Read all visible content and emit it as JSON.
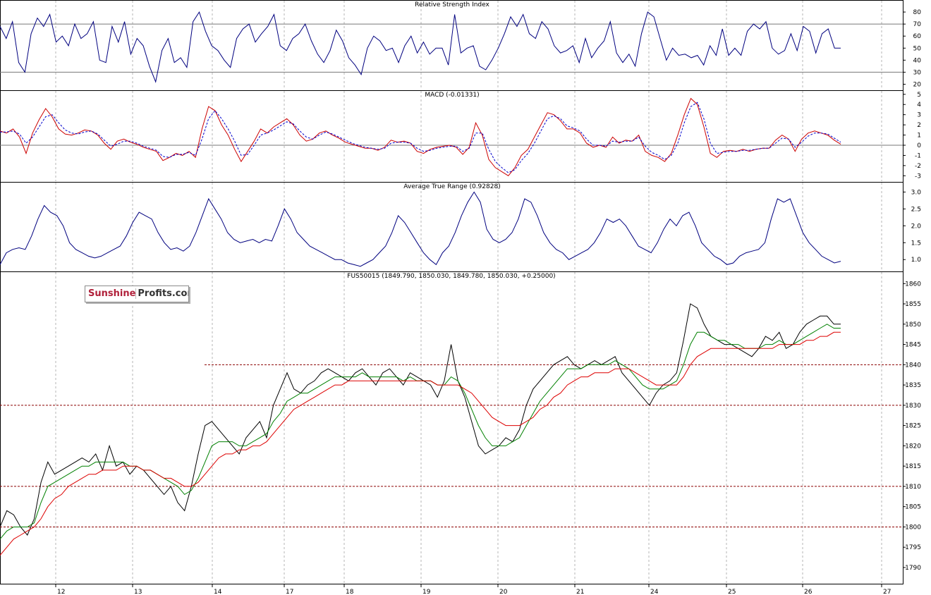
{
  "chart_data": [
    {
      "type": "line",
      "title": "Relative Strength Index",
      "ylim": [
        15,
        90
      ],
      "y_ticks": [
        20,
        30,
        40,
        50,
        60,
        70,
        80
      ],
      "reference_lines": [
        30,
        70
      ],
      "series": [
        {
          "color": "#00007f",
          "values": [
            68,
            58,
            72,
            38,
            30,
            62,
            75,
            68,
            78,
            55,
            60,
            52,
            70,
            58,
            62,
            72,
            40,
            38,
            68,
            55,
            72,
            45,
            58,
            52,
            35,
            22,
            48,
            58,
            38,
            42,
            34,
            72,
            80,
            64,
            52,
            48,
            40,
            34,
            58,
            66,
            70,
            55,
            62,
            68,
            78,
            52,
            48,
            58,
            62,
            70,
            56,
            45,
            38,
            48,
            65,
            56,
            42,
            36,
            28,
            50,
            60,
            56,
            48,
            50,
            38,
            52,
            60,
            46,
            55,
            45,
            50,
            50,
            36,
            78,
            46,
            50,
            52,
            35,
            32,
            40,
            50,
            62,
            76,
            68,
            78,
            62,
            58,
            72,
            66,
            52,
            46,
            48,
            52,
            38,
            58,
            42,
            50,
            56,
            72,
            46,
            38,
            45,
            35,
            62,
            80,
            76,
            58,
            40,
            50,
            44,
            45,
            42,
            44,
            36,
            52,
            44,
            66,
            44,
            50,
            44,
            64,
            70,
            66,
            72,
            50,
            45,
            48,
            62,
            48,
            68,
            64,
            46,
            62,
            66,
            50,
            50
          ]
        }
      ]
    },
    {
      "type": "line",
      "title": "MACD (-0.01331)",
      "ylim": [
        -3.6,
        5.4
      ],
      "y_ticks": [
        -3,
        -2,
        -1,
        0,
        1,
        2,
        3,
        4,
        5
      ],
      "reference_lines": [
        0
      ],
      "series": [
        {
          "color": "#cc0000",
          "values": [
            1.4,
            1.2,
            1.6,
            0.8,
            -0.8,
            1.2,
            2.5,
            3.6,
            2.8,
            1.6,
            1.1,
            1.0,
            1.2,
            1.5,
            1.4,
            1.0,
            0.2,
            -0.4,
            0.4,
            0.6,
            0.3,
            0.1,
            -0.2,
            -0.4,
            -0.6,
            -1.5,
            -1.2,
            -0.8,
            -1.0,
            -0.6,
            -1.2,
            1.6,
            3.8,
            3.4,
            2.0,
            1.0,
            -0.4,
            -1.6,
            -0.6,
            0.4,
            1.6,
            1.2,
            1.8,
            2.2,
            2.6,
            2.0,
            1.0,
            0.4,
            0.6,
            1.2,
            1.4,
            1.0,
            0.7,
            0.3,
            0.1,
            -0.1,
            -0.3,
            -0.3,
            -0.5,
            -0.2,
            0.5,
            0.3,
            0.4,
            0.2,
            -0.6,
            -0.8,
            -0.4,
            -0.2,
            -0.1,
            0.0,
            -0.2,
            -0.9,
            -0.2,
            2.2,
            1.0,
            -1.4,
            -2.2,
            -2.6,
            -3.0,
            -2.2,
            -1.0,
            -0.4,
            0.8,
            2.0,
            3.2,
            3.0,
            2.4,
            1.6,
            1.6,
            1.2,
            0.2,
            -0.2,
            0.0,
            -0.2,
            0.8,
            0.2,
            0.5,
            0.4,
            1.0,
            -0.6,
            -1.0,
            -1.2,
            -1.6,
            -0.8,
            1.0,
            3.0,
            4.6,
            4.0,
            1.8,
            -0.8,
            -1.2,
            -0.6,
            -0.5,
            -0.6,
            -0.4,
            -0.6,
            -0.4,
            -0.3,
            -0.3,
            0.5,
            1.0,
            0.6,
            -0.6,
            0.6,
            1.2,
            1.4,
            1.2,
            1.0,
            0.5,
            0.1
          ]
        },
        {
          "color": "#0000cc",
          "dashed": true,
          "values": [
            1.3,
            1.3,
            1.4,
            1.1,
            0.2,
            0.8,
            1.8,
            2.8,
            3.0,
            2.2,
            1.5,
            1.2,
            1.1,
            1.3,
            1.4,
            1.1,
            0.5,
            -0.1,
            0.1,
            0.4,
            0.4,
            0.2,
            -0.1,
            -0.3,
            -0.5,
            -1.1,
            -1.2,
            -0.9,
            -0.9,
            -0.7,
            -1.0,
            0.6,
            2.6,
            3.4,
            2.6,
            1.6,
            0.4,
            -1.0,
            -0.9,
            0.0,
            1.0,
            1.2,
            1.5,
            1.9,
            2.3,
            2.1,
            1.4,
            0.8,
            0.6,
            1.0,
            1.3,
            1.1,
            0.8,
            0.5,
            0.2,
            0.0,
            -0.2,
            -0.3,
            -0.4,
            -0.3,
            0.2,
            0.3,
            0.3,
            0.2,
            -0.3,
            -0.6,
            -0.5,
            -0.3,
            -0.2,
            -0.1,
            -0.1,
            -0.6,
            -0.3,
            1.2,
            1.2,
            -0.4,
            -1.6,
            -2.2,
            -2.7,
            -2.4,
            -1.5,
            -0.8,
            0.2,
            1.4,
            2.6,
            2.9,
            2.6,
            1.9,
            1.7,
            1.4,
            0.6,
            0.0,
            0.0,
            -0.1,
            0.4,
            0.3,
            0.4,
            0.4,
            0.8,
            -0.1,
            -0.7,
            -1.0,
            -1.4,
            -1.0,
            0.2,
            2.2,
            3.8,
            4.2,
            2.6,
            0.2,
            -0.8,
            -0.7,
            -0.6,
            -0.6,
            -0.5,
            -0.5,
            -0.4,
            -0.3,
            -0.3,
            0.2,
            0.7,
            0.6,
            -0.2,
            0.3,
            0.9,
            1.2,
            1.2,
            1.1,
            0.7,
            0.3
          ]
        }
      ]
    },
    {
      "type": "line",
      "title": "Average True Range (0.92828)",
      "ylim": [
        0.65,
        3.3
      ],
      "y_ticks": [
        1.0,
        1.5,
        2.0,
        2.5,
        3.0
      ],
      "series": [
        {
          "color": "#00007f",
          "values": [
            0.85,
            1.2,
            1.3,
            1.35,
            1.3,
            1.7,
            2.2,
            2.6,
            2.4,
            2.3,
            2.0,
            1.5,
            1.3,
            1.2,
            1.1,
            1.05,
            1.1,
            1.2,
            1.3,
            1.4,
            1.7,
            2.1,
            2.4,
            2.3,
            2.2,
            1.8,
            1.5,
            1.3,
            1.35,
            1.25,
            1.4,
            1.8,
            2.3,
            2.8,
            2.5,
            2.2,
            1.8,
            1.6,
            1.5,
            1.55,
            1.6,
            1.5,
            1.6,
            1.55,
            2.0,
            2.5,
            2.2,
            1.8,
            1.6,
            1.4,
            1.3,
            1.2,
            1.1,
            1.0,
            1.0,
            0.9,
            0.85,
            0.8,
            0.9,
            1.0,
            1.2,
            1.4,
            1.8,
            2.3,
            2.1,
            1.8,
            1.5,
            1.2,
            1.0,
            0.85,
            1.2,
            1.4,
            1.8,
            2.3,
            2.7,
            3.0,
            2.7,
            1.9,
            1.6,
            1.5,
            1.6,
            1.8,
            2.2,
            2.8,
            2.7,
            2.3,
            1.8,
            1.5,
            1.3,
            1.2,
            1.0,
            1.1,
            1.2,
            1.3,
            1.5,
            1.8,
            2.2,
            2.1,
            2.2,
            2.0,
            1.7,
            1.4,
            1.3,
            1.2,
            1.5,
            1.9,
            2.2,
            2.0,
            2.3,
            2.4,
            2.0,
            1.5,
            1.3,
            1.1,
            1.0,
            0.85,
            0.9,
            1.1,
            1.2,
            1.25,
            1.3,
            1.5,
            2.2,
            2.8,
            2.7,
            2.8,
            2.3,
            1.8,
            1.5,
            1.3,
            1.1,
            1.0,
            0.9,
            0.95
          ]
        }
      ]
    },
    {
      "type": "line",
      "title": "FUS50015 (1849.790, 1850.030, 1849.780, 1850.030, +0.25000)",
      "ylim": [
        1786,
        1863
      ],
      "y_ticks": [
        1790,
        1795,
        1800,
        1805,
        1810,
        1815,
        1820,
        1825,
        1830,
        1835,
        1840,
        1845,
        1850,
        1855,
        1860
      ],
      "x_ticks": [
        "12",
        "13",
        "14",
        "17",
        "18",
        "19",
        "20",
        "21",
        "24",
        "25",
        "26",
        "27"
      ],
      "reference_lines": [
        1800,
        1810,
        1830,
        1840
      ],
      "series": [
        {
          "color": "#000000",
          "values": [
            1800,
            1804,
            1803,
            1800,
            1798,
            1802,
            1811,
            1816,
            1813,
            1814,
            1815,
            1816,
            1817,
            1816,
            1818,
            1814,
            1820,
            1815,
            1816,
            1813,
            1815,
            1814,
            1812,
            1810,
            1808,
            1810,
            1806,
            1804,
            1810,
            1818,
            1825,
            1826,
            1824,
            1822,
            1820,
            1818,
            1822,
            1824,
            1826,
            1822,
            1830,
            1834,
            1838,
            1834,
            1833,
            1835,
            1836,
            1838,
            1839,
            1838,
            1837,
            1836,
            1838,
            1839,
            1837,
            1835,
            1838,
            1839,
            1837,
            1835,
            1838,
            1837,
            1836,
            1835,
            1832,
            1836,
            1845,
            1836,
            1832,
            1826,
            1820,
            1818,
            1819,
            1820,
            1822,
            1821,
            1824,
            1830,
            1834,
            1836,
            1838,
            1840,
            1841,
            1842,
            1840,
            1839,
            1840,
            1841,
            1840,
            1841,
            1842,
            1838,
            1836,
            1834,
            1832,
            1830,
            1833,
            1835,
            1836,
            1838,
            1846,
            1855,
            1854,
            1850,
            1847,
            1846,
            1845,
            1845,
            1844,
            1843,
            1842,
            1844,
            1847,
            1846,
            1848,
            1844,
            1845,
            1848,
            1850,
            1851,
            1852,
            1852,
            1850,
            1850
          ]
        },
        {
          "color": "#008000",
          "values": [
            1797,
            1799,
            1800,
            1800,
            1800,
            1801,
            1806,
            1810,
            1811,
            1812,
            1813,
            1814,
            1815,
            1815,
            1816,
            1816,
            1816,
            1816,
            1816,
            1815,
            1815,
            1814,
            1814,
            1813,
            1812,
            1811,
            1810,
            1808,
            1809,
            1812,
            1816,
            1820,
            1821,
            1821,
            1821,
            1820,
            1820,
            1821,
            1822,
            1823,
            1826,
            1828,
            1831,
            1832,
            1833,
            1833,
            1834,
            1835,
            1836,
            1837,
            1837,
            1837,
            1837,
            1838,
            1837,
            1837,
            1837,
            1837,
            1837,
            1836,
            1837,
            1836,
            1836,
            1836,
            1835,
            1835,
            1837,
            1836,
            1833,
            1829,
            1825,
            1822,
            1820,
            1820,
            1820,
            1821,
            1822,
            1825,
            1828,
            1831,
            1833,
            1835,
            1837,
            1839,
            1839,
            1839,
            1840,
            1840,
            1840,
            1840,
            1841,
            1840,
            1839,
            1837,
            1835,
            1834,
            1834,
            1834,
            1835,
            1836,
            1840,
            1845,
            1848,
            1848,
            1847,
            1846,
            1846,
            1845,
            1845,
            1844,
            1844,
            1844,
            1845,
            1845,
            1846,
            1845,
            1845,
            1846,
            1847,
            1848,
            1849,
            1850,
            1849,
            1849
          ]
        },
        {
          "color": "#dd0000",
          "values": [
            1793,
            1795,
            1797,
            1798,
            1799,
            1800,
            1802,
            1805,
            1807,
            1808,
            1810,
            1811,
            1812,
            1813,
            1813,
            1814,
            1814,
            1814,
            1815,
            1815,
            1815,
            1814,
            1814,
            1813,
            1812,
            1812,
            1811,
            1810,
            1810,
            1811,
            1813,
            1815,
            1817,
            1818,
            1818,
            1819,
            1819,
            1820,
            1820,
            1821,
            1823,
            1825,
            1827,
            1829,
            1830,
            1831,
            1832,
            1833,
            1834,
            1835,
            1835,
            1836,
            1836,
            1836,
            1836,
            1836,
            1836,
            1836,
            1836,
            1836,
            1836,
            1836,
            1836,
            1836,
            1835,
            1835,
            1835,
            1835,
            1834,
            1833,
            1831,
            1829,
            1827,
            1826,
            1825,
            1825,
            1825,
            1826,
            1827,
            1829,
            1830,
            1832,
            1833,
            1835,
            1836,
            1837,
            1837,
            1838,
            1838,
            1838,
            1839,
            1839,
            1839,
            1838,
            1837,
            1836,
            1835,
            1835,
            1835,
            1835,
            1837,
            1840,
            1842,
            1843,
            1844,
            1844,
            1844,
            1844,
            1844,
            1844,
            1844,
            1844,
            1844,
            1844,
            1845,
            1845,
            1845,
            1845,
            1846,
            1846,
            1847,
            1847,
            1848,
            1848
          ]
        }
      ]
    }
  ],
  "logo": {
    "part1": "Sunshine",
    "part2": "Profits.com"
  }
}
